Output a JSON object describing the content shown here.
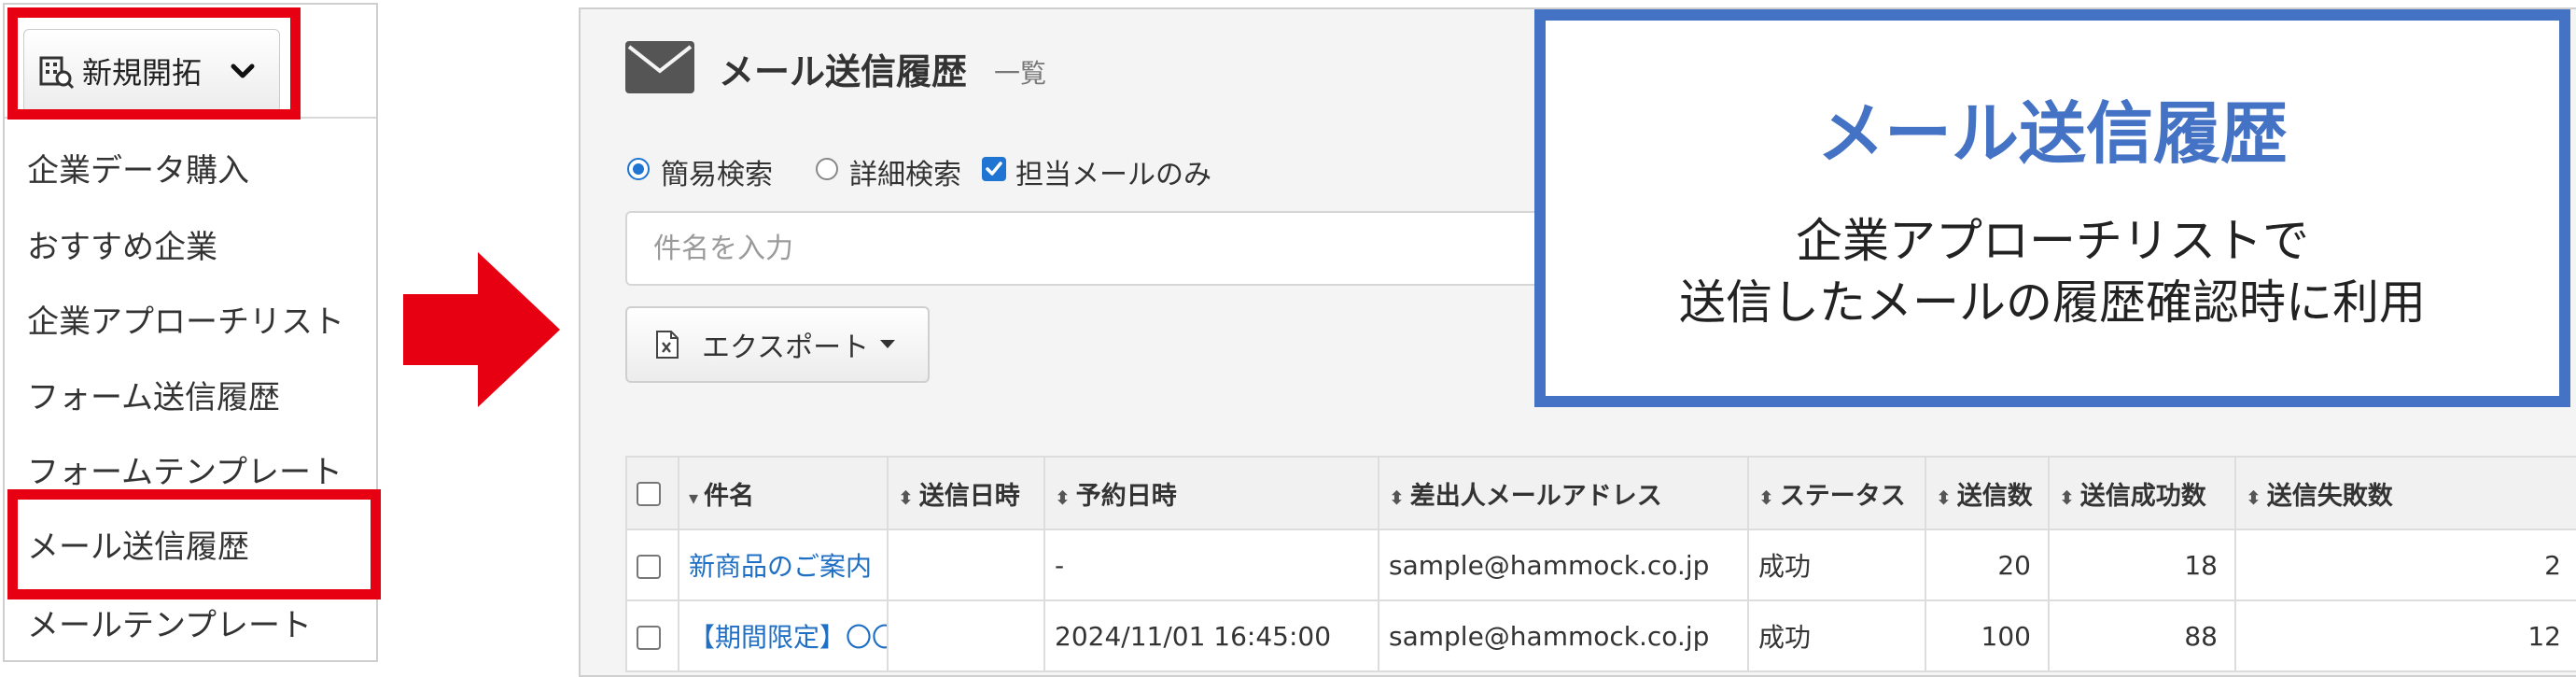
{
  "menu": {
    "button_label": "新規開拓",
    "items": [
      "企業データ購入",
      "おすすめ企業",
      "企業アプローチリスト",
      "フォーム送信履歴",
      "フォームテンプレート",
      "メール送信履歴",
      "メールテンプレート"
    ],
    "highlighted_item": "メール送信履歴"
  },
  "screen": {
    "title": "メール送信履歴",
    "subtitle": "一覧",
    "search_options": [
      {
        "label": "簡易検索",
        "type": "radio",
        "checked": true
      },
      {
        "label": "詳細検索",
        "type": "radio",
        "checked": false
      },
      {
        "label": "担当メールのみ",
        "type": "checkbox",
        "checked": true
      }
    ],
    "search_placeholder": "件名を入力",
    "export_label": "エクスポート",
    "table": {
      "columns": [
        "件名",
        "送信日時",
        "予約日時",
        "差出人メールアドレス",
        "ステータス",
        "送信数",
        "送信成功数",
        "送信失敗数"
      ],
      "rows": [
        [
          "新商品のご案内",
          "",
          "-",
          "sample@hammock.co.jp",
          "成功",
          "20",
          "18",
          "2"
        ],
        [
          "【期間限定】〇〇のご案内",
          "",
          "2024/11/01 16:45:00",
          "sample@hammock.co.jp",
          "成功",
          "100",
          "88",
          "12"
        ]
      ]
    }
  },
  "callout": {
    "title": "メール送信履歴",
    "line1": "企業アプローチリストで",
    "line2": "送信したメールの履歴確認時に利用"
  },
  "colors": {
    "highlight_red": "#e60012",
    "callout_blue": "#4472c4",
    "link_blue": "#1f6fc5",
    "accent_blue": "#1f75d1"
  }
}
